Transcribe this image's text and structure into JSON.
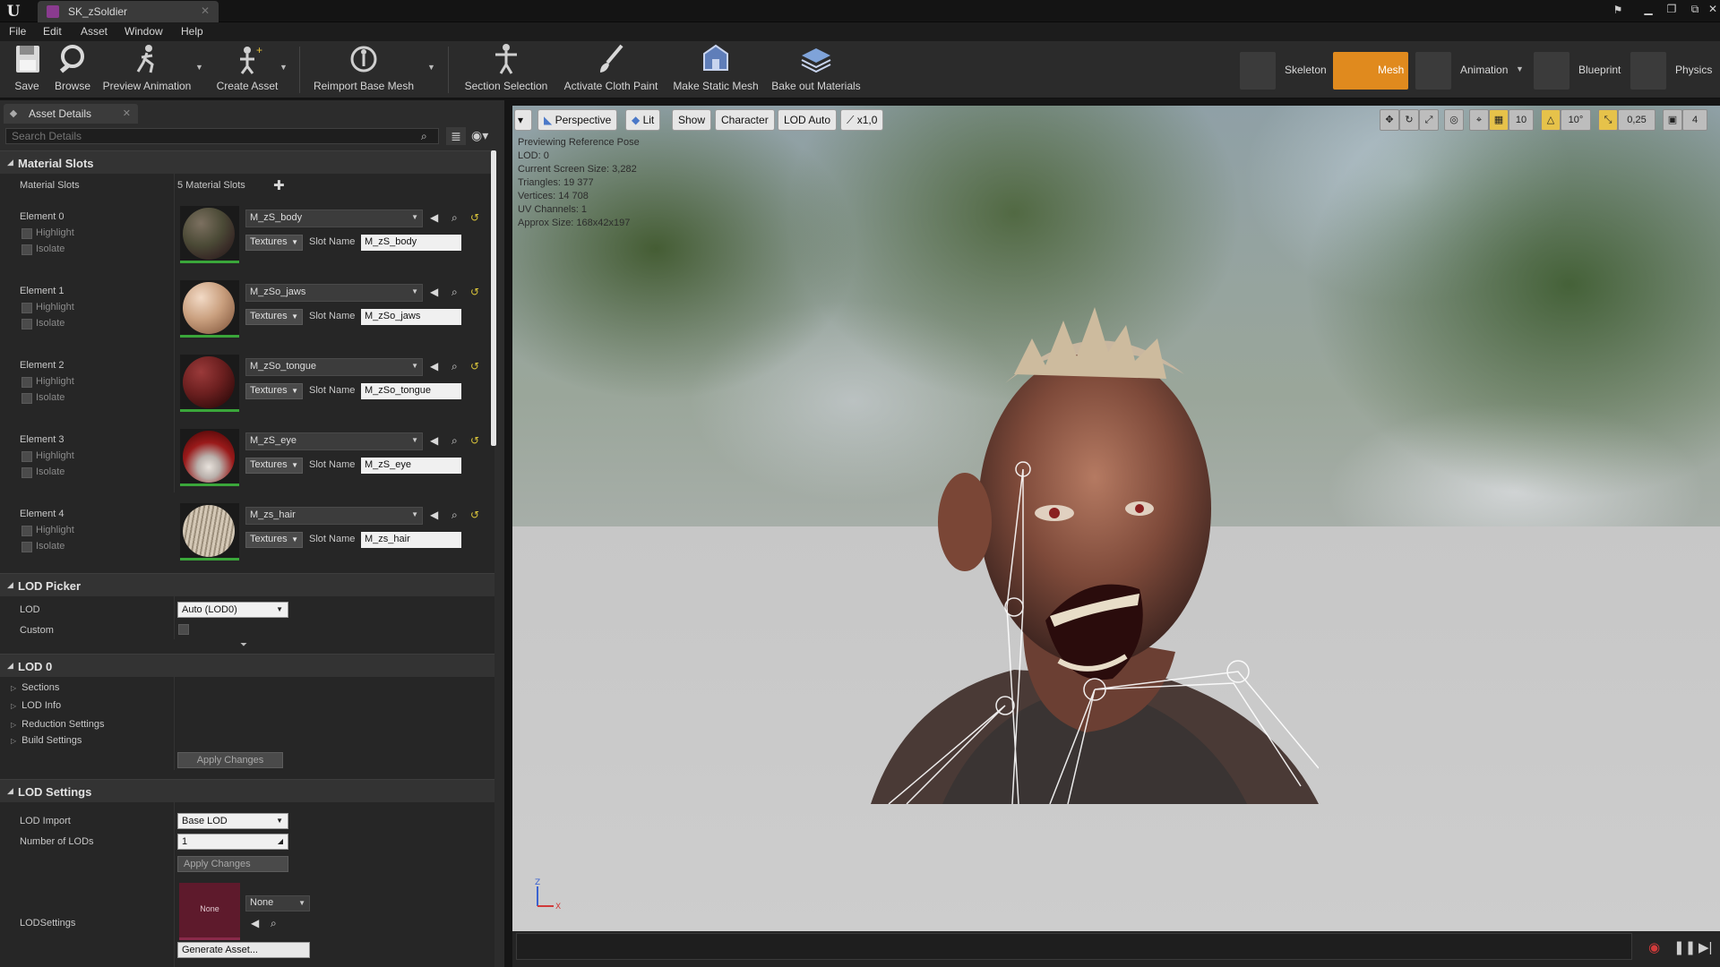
{
  "title_bar": {
    "tab_label": "SK_zSoldier"
  },
  "menu": [
    "File",
    "Edit",
    "Asset",
    "Window",
    "Help"
  ],
  "toolbar": {
    "buttons": [
      "Save",
      "Browse",
      "Preview Animation",
      "Create Asset",
      "Reimport Base Mesh",
      "Section Selection",
      "Activate Cloth Paint",
      "Make Static Mesh",
      "Bake out Materials"
    ],
    "modes": [
      "Skeleton",
      "Mesh",
      "Animation",
      "Blueprint",
      "Physics"
    ],
    "active_mode": "Mesh",
    "accent_color": "#e08a1e"
  },
  "panel": {
    "tab_label": "Asset Details",
    "search_placeholder": "Search Details",
    "material_slots": {
      "header": "Material Slots",
      "label": "Material Slots",
      "count_label": "5 Material Slots",
      "elements": [
        {
          "name": "Element 0",
          "material": "M_zS_body",
          "slot_name": "M_zS_body"
        },
        {
          "name": "Element 1",
          "material": "M_zSo_jaws",
          "slot_name": "M_zSo_jaws"
        },
        {
          "name": "Element 2",
          "material": "M_zSo_tongue",
          "slot_name": "M_zSo_tongue"
        },
        {
          "name": "Element 3",
          "material": "M_zS_eye",
          "slot_name": "M_zS_eye"
        },
        {
          "name": "Element 4",
          "material": "M_zs_hair",
          "slot_name": "M_zs_hair"
        }
      ],
      "highlight_label": "Highlight",
      "isolate_label": "Isolate",
      "textures_label": "Textures",
      "slot_name_label": "Slot Name"
    },
    "lod_picker": {
      "header": "LOD Picker",
      "lod_label": "LOD",
      "lod_value": "Auto (LOD0)",
      "custom_label": "Custom"
    },
    "lod0": {
      "header": "LOD 0",
      "items": [
        "Sections",
        "LOD Info",
        "Reduction Settings",
        "Build Settings"
      ],
      "apply_label": "Apply Changes"
    },
    "lod_settings": {
      "header": "LOD Settings",
      "import_label": "LOD Import",
      "import_value": "Base LOD",
      "num_label": "Number of LODs",
      "num_value": "1",
      "apply_label": "Apply Changes",
      "lodsettings_label": "LODSettings",
      "asset_thumb_label": "None",
      "asset_value": "None",
      "generate_label": "Generate Asset..."
    }
  },
  "viewport": {
    "buttons": [
      "Perspective",
      "Lit",
      "Show",
      "Character",
      "LOD Auto",
      "x1,0"
    ],
    "grid_snap": "10",
    "rot_snap": "10°",
    "scale_snap": "0,25",
    "cam_speed": "4",
    "info_lines": [
      "Previewing Reference Pose",
      "LOD: 0",
      "Current Screen Size: 3,282",
      "Triangles: 19 377",
      "Vertices: 14 708",
      "UV Channels: 1",
      "Approx Size: 168x42x197"
    ],
    "axis_z": "Z",
    "axis_x": "X"
  }
}
